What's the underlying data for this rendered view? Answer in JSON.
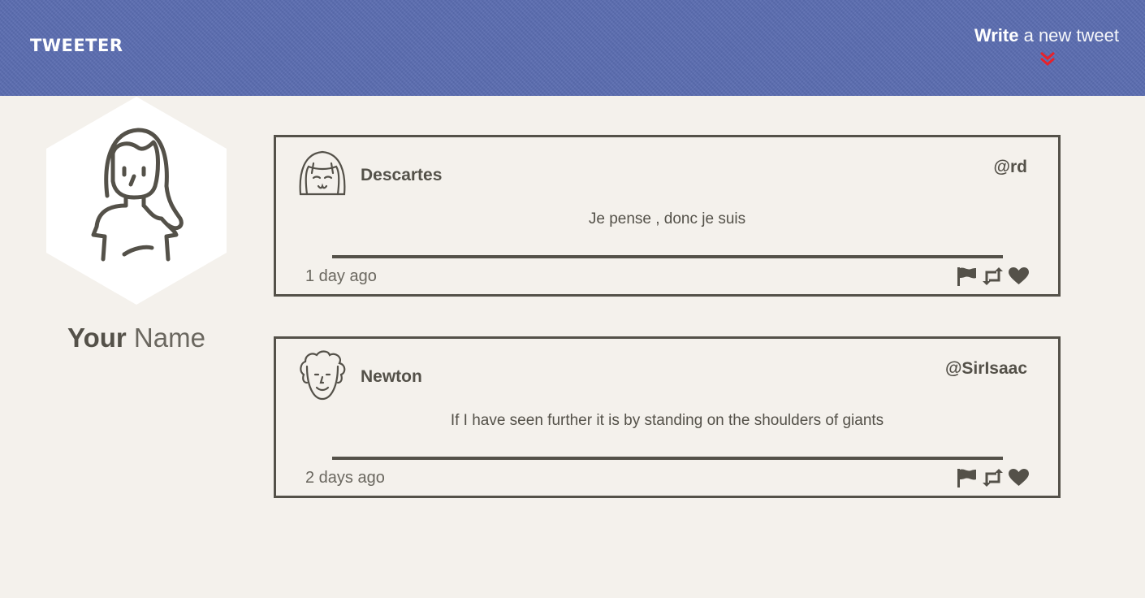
{
  "nav": {
    "brand": "TWEETER",
    "compose_strong": "Write",
    "compose_rest": " a new tweet",
    "accent_color": "#e8212a",
    "background_color": "#5b6db1"
  },
  "profile": {
    "name_first": "Your",
    "name_rest": " Name"
  },
  "tweets": [
    {
      "name": "Descartes",
      "handle": "@rd",
      "text": "Je pense , donc je suis",
      "time": "1 day ago",
      "avatar_icon": "girl-bangs-avatar-icon"
    },
    {
      "name": "Newton",
      "handle": "@SirIsaac",
      "text": "If I have seen further it is by standing on the shoulders of giants",
      "time": "2 days ago",
      "avatar_icon": "curly-hair-avatar-icon"
    }
  ],
  "actions": [
    "flag-icon",
    "retweet-icon",
    "heart-icon"
  ]
}
